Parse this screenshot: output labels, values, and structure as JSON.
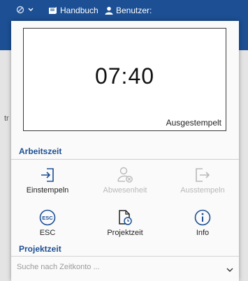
{
  "topbar": {
    "handbook_label": "Handbuch",
    "user_label": "Benutzer:"
  },
  "background": {
    "stub_text": "tr"
  },
  "clock": {
    "time": "07:40",
    "status": "Ausgestempelt"
  },
  "arbeitszeit": {
    "title": "Arbeitszeit",
    "actions": [
      {
        "label": "Einstempeln",
        "icon": "clock-in-icon",
        "enabled": true
      },
      {
        "label": "Abwesenheit",
        "icon": "absence-icon",
        "enabled": false
      },
      {
        "label": "Ausstempeln",
        "icon": "clock-out-icon",
        "enabled": false
      },
      {
        "label": "ESC",
        "icon": "esc-icon",
        "enabled": true
      },
      {
        "label": "Projektzeit",
        "icon": "project-time-icon",
        "enabled": true
      },
      {
        "label": "Info",
        "icon": "info-icon",
        "enabled": true
      }
    ]
  },
  "projektzeit": {
    "title": "Projektzeit",
    "search_placeholder": "Suche nach Zeitkonto ..."
  },
  "colors": {
    "brand": "#1c4f93",
    "disabled": "#b9b9b9"
  }
}
